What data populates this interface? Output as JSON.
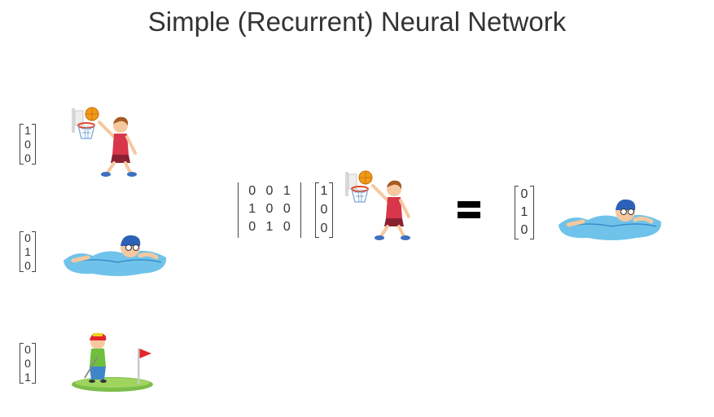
{
  "title": "Simple (Recurrent) Neural Network",
  "activities": [
    {
      "name": "basketball",
      "vector": [
        "1",
        "0",
        "0"
      ]
    },
    {
      "name": "swimming",
      "vector": [
        "0",
        "1",
        "0"
      ]
    },
    {
      "name": "golf",
      "vector": [
        "0",
        "0",
        "1"
      ]
    }
  ],
  "equation": {
    "matrix": [
      [
        "0",
        "0",
        "1"
      ],
      [
        "1",
        "0",
        "0"
      ],
      [
        "0",
        "1",
        "0"
      ]
    ],
    "input_vector": [
      "1",
      "0",
      "0"
    ],
    "output_vector": [
      "0",
      "1",
      "0"
    ]
  },
  "icons": {
    "basketball": "basketball-player-icon",
    "swimming": "swimmer-icon",
    "golf": "golfer-icon",
    "equals": "equals-sign"
  }
}
